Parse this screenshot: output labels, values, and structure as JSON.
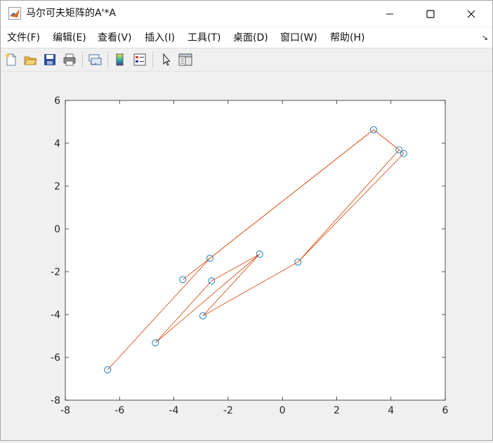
{
  "window": {
    "title": "马尔可夫矩阵的A'*A"
  },
  "menu": {
    "items": [
      {
        "label": "文件(F)"
      },
      {
        "label": "编辑(E)"
      },
      {
        "label": "查看(V)"
      },
      {
        "label": "插入(I)"
      },
      {
        "label": "工具(T)"
      },
      {
        "label": "桌面(D)"
      },
      {
        "label": "窗口(W)"
      },
      {
        "label": "帮助(H)"
      }
    ],
    "more_icon": "dock-arrow-icon"
  },
  "toolbar": {
    "buttons": [
      "new-figure-icon",
      "open-file-icon",
      "save-icon",
      "print-icon",
      "link-plot-icon",
      "colorbar-icon",
      "legend-icon",
      "pointer-icon",
      "property-editor-icon"
    ]
  },
  "colors": {
    "line": "#d95319",
    "marker": "#0072bd",
    "axes": "#262626"
  },
  "chart_data": {
    "type": "line",
    "title": "",
    "xlabel": "",
    "ylabel": "",
    "xlim": [
      -8,
      6
    ],
    "ylim": [
      -8,
      6
    ],
    "x_ticks": [
      "-8",
      "-6",
      "-4",
      "-2",
      "0",
      "2",
      "4",
      "6"
    ],
    "y_ticks": [
      "6",
      "4",
      "2",
      "0",
      "-2",
      "-4",
      "-6",
      "-8"
    ],
    "grid": false,
    "series": [
      {
        "style": "line",
        "color": "#d95319",
        "x": [
          -6.44,
          -2.67,
          3.36,
          4.47,
          0.57,
          -2.93,
          -0.84,
          -4.68,
          -2.61,
          -0.84
        ],
        "y": [
          -6.58,
          -1.37,
          4.63,
          3.52,
          -1.55,
          -4.06,
          -1.18,
          -5.32,
          -2.43,
          -1.18
        ]
      },
      {
        "style": "line",
        "color": "#d95319",
        "x": [
          -3.67,
          -2.67,
          3.36,
          4.3,
          0.57
        ],
        "y": [
          -2.37,
          -1.37,
          4.63,
          3.69,
          -1.55
        ]
      },
      {
        "style": "markers",
        "marker": "circle",
        "color": "#0072bd",
        "x": [
          3.36,
          4.3,
          4.47,
          -2.67,
          -0.84,
          0.57,
          -3.67,
          -2.61,
          -2.93,
          -4.68,
          -6.44
        ],
        "y": [
          4.63,
          3.69,
          3.52,
          -1.37,
          -1.18,
          -1.55,
          -2.37,
          -2.43,
          -4.06,
          -5.32,
          -6.58
        ]
      }
    ]
  }
}
